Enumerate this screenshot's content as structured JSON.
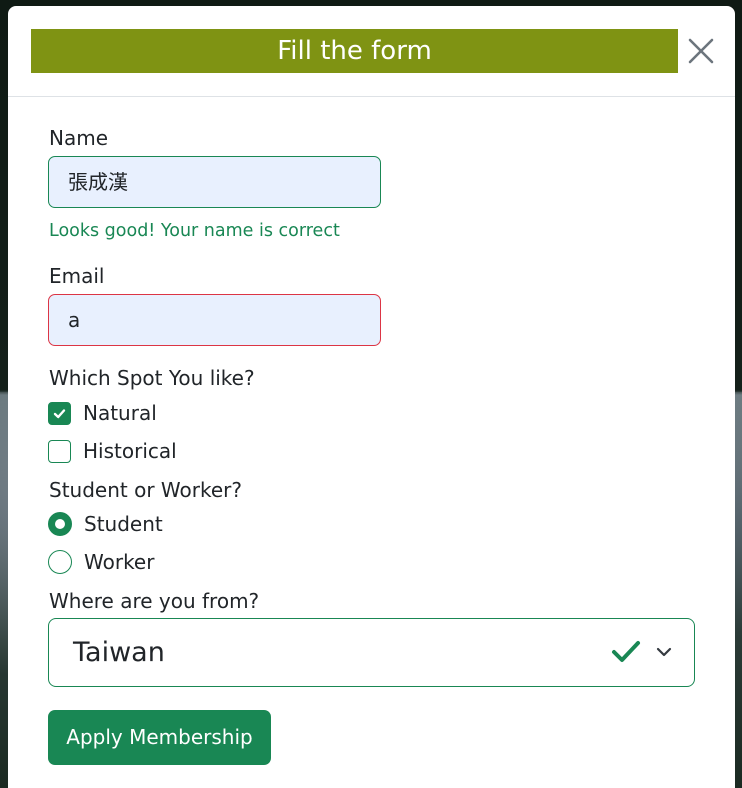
{
  "modal": {
    "title": "Fill the form",
    "title_bar_color": "#7f9313",
    "close_icon": "close-icon"
  },
  "form": {
    "name": {
      "label": "Name",
      "value": "張成漢",
      "feedback": "Looks good! Your name is correct",
      "state": "valid"
    },
    "email": {
      "label": "Email",
      "value": "a",
      "state": "invalid"
    },
    "spots": {
      "label": "Which Spot You like?",
      "options": [
        {
          "label": "Natural",
          "checked": true
        },
        {
          "label": "Historical",
          "checked": false
        }
      ]
    },
    "role": {
      "label": "Student or Worker?",
      "options": [
        {
          "label": "Student",
          "selected": true
        },
        {
          "label": "Worker",
          "selected": false
        }
      ]
    },
    "country": {
      "label": "Where are you from?",
      "selected": "Taiwan",
      "state": "valid"
    },
    "submit_label": "Apply Membership"
  },
  "colors": {
    "success": "#198754",
    "danger": "#dc3545",
    "autofill_bg": "#e8f0fe"
  }
}
